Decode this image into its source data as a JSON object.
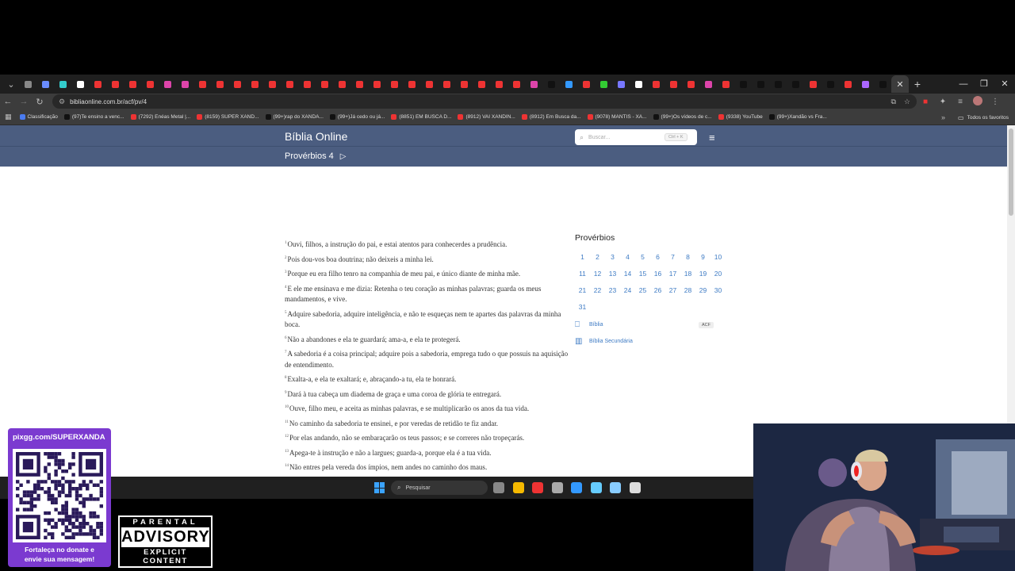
{
  "browser": {
    "url": "bibliaonline.com.br/acf/pv/4",
    "tab_colors": [
      "#888",
      "#6a8cff",
      "#3cc",
      "#fff",
      "#e33",
      "#e33",
      "#e33",
      "#e33",
      "#d4a",
      "#d4a",
      "#e33",
      "#e33",
      "#e33",
      "#e33",
      "#e33",
      "#e33",
      "#e33",
      "#e33",
      "#e33",
      "#e33",
      "#e33",
      "#e33",
      "#e33",
      "#e33",
      "#e33",
      "#e33",
      "#e33",
      "#e33",
      "#e33",
      "#d4a",
      "#111",
      "#39f",
      "#e33",
      "#3c3",
      "#77f",
      "#fff",
      "#e33",
      "#e33",
      "#e33",
      "#d4a",
      "#e33",
      "#111",
      "#111",
      "#111",
      "#111",
      "#e33",
      "#111",
      "#e33",
      "#a6f",
      "#111"
    ],
    "bookmarks": [
      {
        "label": "Classificação",
        "color": "#4a7bf0"
      },
      {
        "label": "(97)Te ensino a venc...",
        "color": "#111"
      },
      {
        "label": "(7292) Enéas Metal |...",
        "color": "#e33"
      },
      {
        "label": "(8159) SUPER XAND...",
        "color": "#e33"
      },
      {
        "label": "(99+)rap do XANDÃ...",
        "color": "#111"
      },
      {
        "label": "(99+)Já cedo ou já...",
        "color": "#111"
      },
      {
        "label": "(8851) EM BUSCA D...",
        "color": "#e33"
      },
      {
        "label": "(8912) VAI XANDIN...",
        "color": "#e33"
      },
      {
        "label": "(8912) Em Busca da...",
        "color": "#e33"
      },
      {
        "label": "(9078) MANTIS - XA...",
        "color": "#e33"
      },
      {
        "label": "(99+)Os vídeos de c...",
        "color": "#111"
      },
      {
        "label": "(9338) YouTube",
        "color": "#e33"
      },
      {
        "label": "(99+)Xandão vs Fra...",
        "color": "#111"
      }
    ],
    "all_bookmarks_label": "Todos os favoritos"
  },
  "site": {
    "title": "Bíblia Online",
    "chapter_label": "Provérbios 4",
    "search_placeholder": "Buscar...",
    "search_shortcut": "Ctrl + K"
  },
  "verses": [
    {
      "n": "1",
      "text": "Ouvi, filhos, a instrução do pai, e estai atentos para conhecerdes a prudência."
    },
    {
      "n": "2",
      "text": "Pois dou-vos boa doutrina; não deixeis a minha lei."
    },
    {
      "n": "3",
      "text": "Porque eu era filho tenro na companhia de meu pai, e único diante de minha mãe."
    },
    {
      "n": "4",
      "text": "E ele me ensinava e me dizia: Retenha o teu coração as minhas palavras; guarda os meus mandamentos, e vive."
    },
    {
      "n": "5",
      "text": "Adquire sabedoria, adquire inteligência, e não te esqueças nem te apartes das palavras da minha boca."
    },
    {
      "n": "6",
      "text": "Não a abandones e ela te guardará; ama-a, e ela te protegerá."
    },
    {
      "n": "7",
      "text": "A sabedoria é a coisa principal; adquire pois a sabedoria, emprega tudo o que possuis na aquisição de entendimento."
    },
    {
      "n": "8",
      "text": "Exalta-a, e ela te exaltará; e, abraçando-a tu, ela te honrará."
    },
    {
      "n": "9",
      "text": "Dará à tua cabeça um diadema de graça e uma coroa de glória te entregará."
    },
    {
      "n": "10",
      "text": "Ouve, filho meu, e aceita as minhas palavras, e se multiplicarão os anos da tua vida."
    },
    {
      "n": "11",
      "text": "No caminho da sabedoria te ensinei, e por veredas de retidão te fiz andar."
    },
    {
      "n": "12",
      "text": "Por elas andando, não se embaraçarão os teus passos; e se correres não tropeçarás."
    },
    {
      "n": "13",
      "text": "Apega-te à instrução e não a largues; guarda-a, porque ela é a tua vida."
    },
    {
      "n": "14",
      "text": "Não entres pela vereda dos ímpios, nem andes no caminho dos maus."
    }
  ],
  "sidebar": {
    "book_title": "Provérbios",
    "chapters": [
      "1",
      "2",
      "3",
      "4",
      "5",
      "6",
      "7",
      "8",
      "9",
      "10",
      "11",
      "12",
      "13",
      "14",
      "15",
      "16",
      "17",
      "18",
      "19",
      "20",
      "21",
      "22",
      "23",
      "24",
      "25",
      "26",
      "27",
      "28",
      "29",
      "30",
      "31"
    ],
    "links": [
      {
        "label": "Bíblia",
        "badge": "ACF",
        "icon": "book-open-icon"
      },
      {
        "label": "Bíblia Secundária",
        "badge": "",
        "icon": "books-icon"
      }
    ]
  },
  "taskbar": {
    "search_label": "Pesquisar",
    "app_colors": [
      "#888",
      "#f5b900",
      "#e33",
      "#aaa",
      "#39f",
      "#6cf",
      "#8cf",
      "#ddd"
    ]
  },
  "overlay": {
    "donate_url": "pixgg.com/SUPERXANDA",
    "donate_message_line1": "Fortaleça no donate e",
    "donate_message_line2": "envie sua mensagem!",
    "advisory_top": "PARENTAL",
    "advisory_mid": "ADVISORY",
    "advisory_bot": "EXPLICIT CONTENT"
  },
  "colors": {
    "header_bg": "#4b5d80",
    "link": "#3e7bc4",
    "donate_bg": "#7b3ad0"
  }
}
